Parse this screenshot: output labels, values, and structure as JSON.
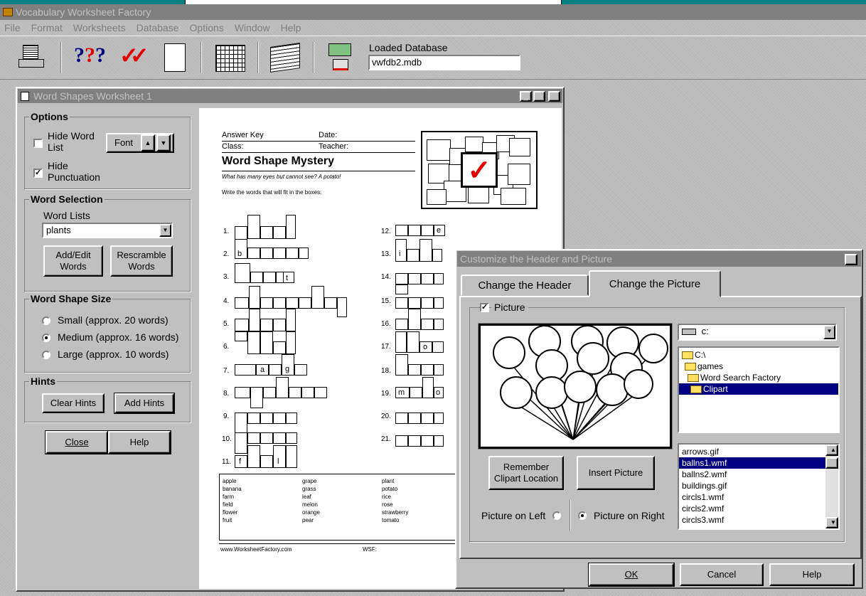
{
  "app": {
    "title": "Vocabulary Worksheet Factory"
  },
  "menu": [
    "File",
    "Format",
    "Worksheets",
    "Database",
    "Options",
    "Window",
    "Help"
  ],
  "toolbar": {
    "loaded_db_label": "Loaded Database",
    "loaded_db_value": "vwfdb2.mdb"
  },
  "ws_window": {
    "title": "Word Shapes Worksheet 1",
    "options": {
      "title": "Options",
      "hide_word_list": "Hide Word List",
      "hide_punctuation": "Hide Punctuation",
      "font": "Font",
      "hide_word_list_checked": false,
      "hide_punctuation_checked": true
    },
    "word_selection": {
      "title": "Word Selection",
      "word_lists_label": "Word Lists",
      "selected_list": "plants",
      "add_edit": "Add/Edit Words",
      "rescramble": "Rescramble Words"
    },
    "size": {
      "title": "Word Shape Size",
      "small": "Small (approx. 20 words)",
      "medium": "Medium (approx. 16 words)",
      "large": "Large (approx. 10 words)",
      "selected": "medium"
    },
    "hints": {
      "title": "Hints",
      "clear": "Clear Hints",
      "add": "Add Hints"
    },
    "close": "Close",
    "help": "Help"
  },
  "worksheet": {
    "answer_key": "Answer Key",
    "date": "Date:",
    "class": "Class:",
    "teacher": "Teacher:",
    "title": "Word Shape Mystery",
    "riddle": "What has many eyes but cannot see? A potato!",
    "instructions": "Write the words that will fit in the boxes.",
    "numbers_left": [
      "1.",
      "2.",
      "3.",
      "4.",
      "5.",
      "6.",
      "7.",
      "8.",
      "9.",
      "10.",
      "11."
    ],
    "numbers_right": [
      "12.",
      "13.",
      "14.",
      "15.",
      "16.",
      "17.",
      "18.",
      "19.",
      "20.",
      "21."
    ],
    "word_bank": [
      [
        "apple",
        "banana",
        "farm",
        "field",
        "flower",
        "fruit"
      ],
      [
        "grape",
        "grass",
        "leaf",
        "melon",
        "orange",
        "pear"
      ],
      [
        "plant",
        "potato",
        "rice",
        "rose",
        "strawberry",
        "tomato"
      ]
    ],
    "footer_url": "www.WorksheetFactory.com",
    "footer_wsf": "WSF:"
  },
  "dialog": {
    "title": "Customize the Header and Picture",
    "tabs": [
      "Change the Header",
      "Change the Picture"
    ],
    "active_tab": 1,
    "picture_label": "Picture",
    "picture_checked": true,
    "drive": "c:",
    "folders": [
      "C:\\",
      "games",
      "Word Search Factory",
      "Clipart"
    ],
    "selected_folder": "Clipart",
    "files": [
      "arrows.gif",
      "ballns1.wmf",
      "ballns2.wmf",
      "buildings.gif",
      "circls1.wmf",
      "circls2.wmf",
      "circls3.wmf"
    ],
    "selected_file": "ballns1.wmf",
    "remember": "Remember Clipart Location",
    "insert": "Insert Picture",
    "pic_left": "Picture on Left",
    "pic_right": "Picture on Right",
    "pic_position": "right",
    "ok": "OK",
    "cancel": "Cancel",
    "help": "Help"
  },
  "colors": {
    "desktop": "#008080",
    "active_title": "#000080",
    "inactive_title": "#808080",
    "check_red": "#e00000"
  }
}
